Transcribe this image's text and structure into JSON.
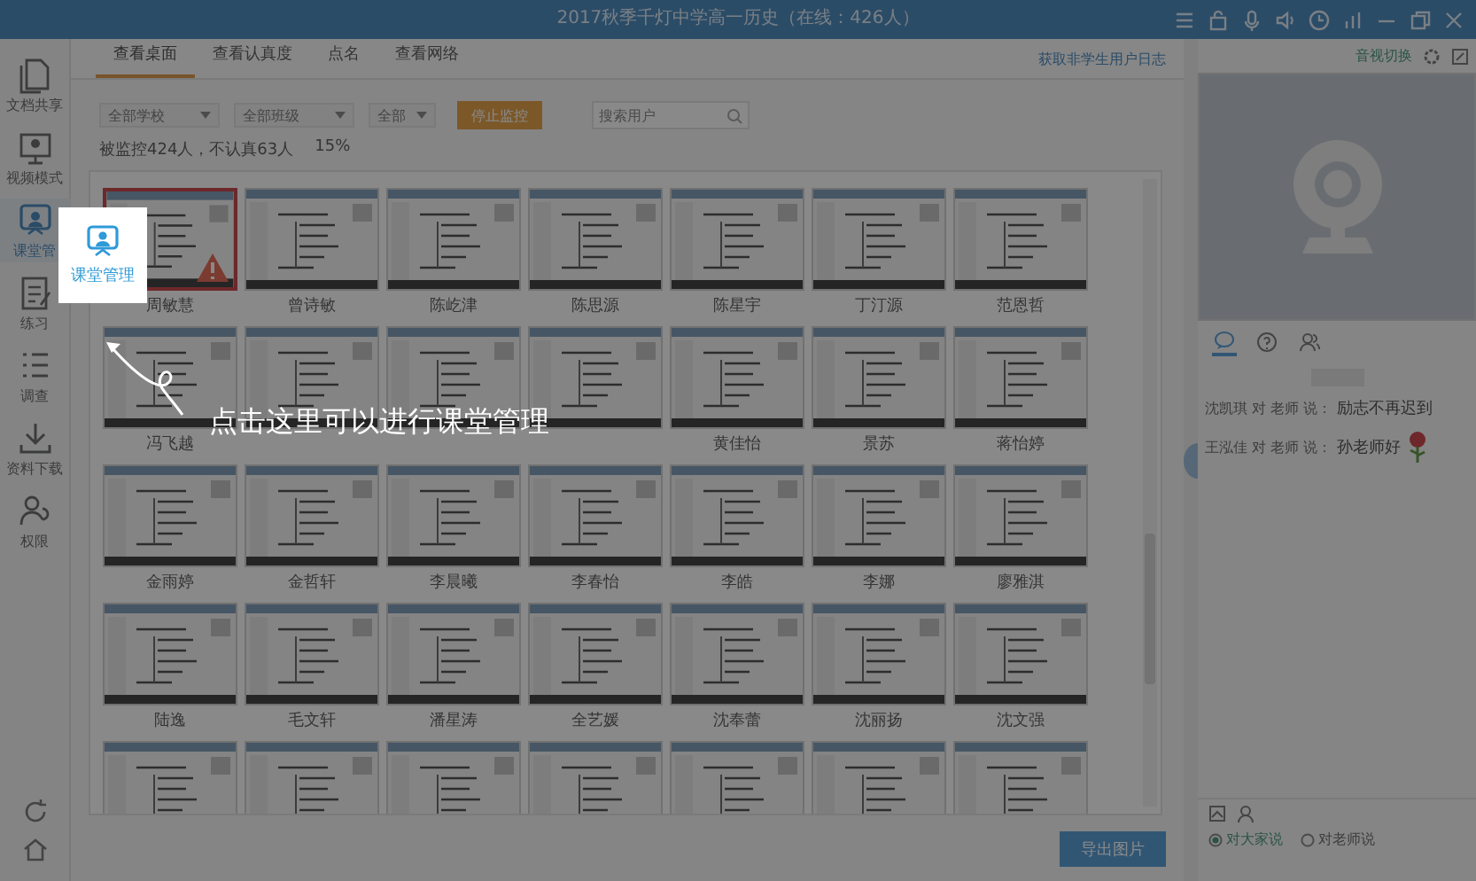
{
  "window": {
    "title": "2017秋季千灯中学高一历史（在线：426人）"
  },
  "sidebar": {
    "items": [
      {
        "label": "文档共享",
        "selected": false
      },
      {
        "label": "视频模式",
        "selected": false
      },
      {
        "label": "课堂管",
        "selected": true
      },
      {
        "label": "练习",
        "selected": false
      },
      {
        "label": "调查",
        "selected": false
      },
      {
        "label": "资料下载",
        "selected": false
      },
      {
        "label": "权限",
        "selected": false
      }
    ]
  },
  "tabs": [
    {
      "label": "查看桌面",
      "selected": true
    },
    {
      "label": "查看认真度",
      "selected": false
    },
    {
      "label": "点名",
      "selected": false
    },
    {
      "label": "查看网络",
      "selected": false
    }
  ],
  "log_link": "获取非学生用户日志",
  "filters": [
    {
      "value": "全部学校"
    },
    {
      "value": "全部班级"
    },
    {
      "value": "全部"
    }
  ],
  "stop_button": "停止监控",
  "search": {
    "placeholder": "搜索用户"
  },
  "summary": "被监控424人，不认真63人",
  "percent": "15%",
  "students": [
    {
      "name": "周敏慧",
      "warning": true
    },
    {
      "name": "曾诗敏",
      "warning": false
    },
    {
      "name": "陈屹津",
      "warning": false
    },
    {
      "name": "陈思源",
      "warning": false
    },
    {
      "name": "陈星宇",
      "warning": false
    },
    {
      "name": "丁汀源",
      "warning": false
    },
    {
      "name": "范恩哲",
      "warning": false
    },
    {
      "name": "冯飞越",
      "warning": false
    },
    {
      "warning": false
    },
    {
      "warning": false
    },
    {
      "warning": false
    },
    {
      "name": "黄佳怡",
      "warning": false
    },
    {
      "name": "景苏",
      "warning": false
    },
    {
      "name": "蒋怡婷",
      "warning": false
    },
    {
      "name": "金雨婷",
      "warning": false
    },
    {
      "name": "金哲轩",
      "warning": false
    },
    {
      "name": "李晨曦",
      "warning": false
    },
    {
      "name": "李春怡",
      "warning": false
    },
    {
      "name": "李皓",
      "warning": false
    },
    {
      "name": "李娜",
      "warning": false
    },
    {
      "name": "廖雅淇",
      "warning": false
    },
    {
      "name": "陆逸",
      "warning": false
    },
    {
      "name": "毛文轩",
      "warning": false
    },
    {
      "name": "潘星涛",
      "warning": false
    },
    {
      "name": "全艺媛",
      "warning": false
    },
    {
      "name": "沈奉蕾",
      "warning": false
    },
    {
      "name": "沈丽扬",
      "warning": false
    },
    {
      "name": "沈文强",
      "warning": false
    },
    {
      "warning": false
    },
    {
      "warning": false
    },
    {
      "warning": false
    },
    {
      "warning": false
    },
    {
      "warning": false
    },
    {
      "warning": false
    },
    {
      "warning": false
    }
  ],
  "export_button": "导出图片",
  "right_panel": {
    "switch_link": "音视切换",
    "chat_tabs": [
      {
        "selected": true
      },
      {
        "selected": false
      },
      {
        "selected": false
      }
    ],
    "messages": [
      {
        "line": "沈凯琪 对 老师 说：",
        "text": "励志不再迟到",
        "sticker": false
      },
      {
        "line": "王泓佳 对 老师 说：",
        "text": "孙老师好",
        "sticker": true
      }
    ],
    "audience": [
      {
        "label": "对大家说",
        "selected": true
      },
      {
        "label": "对老师说",
        "selected": false
      }
    ]
  },
  "guide": {
    "tooltip": "课堂管理",
    "callout": "点击这里可以进行课堂管理"
  }
}
